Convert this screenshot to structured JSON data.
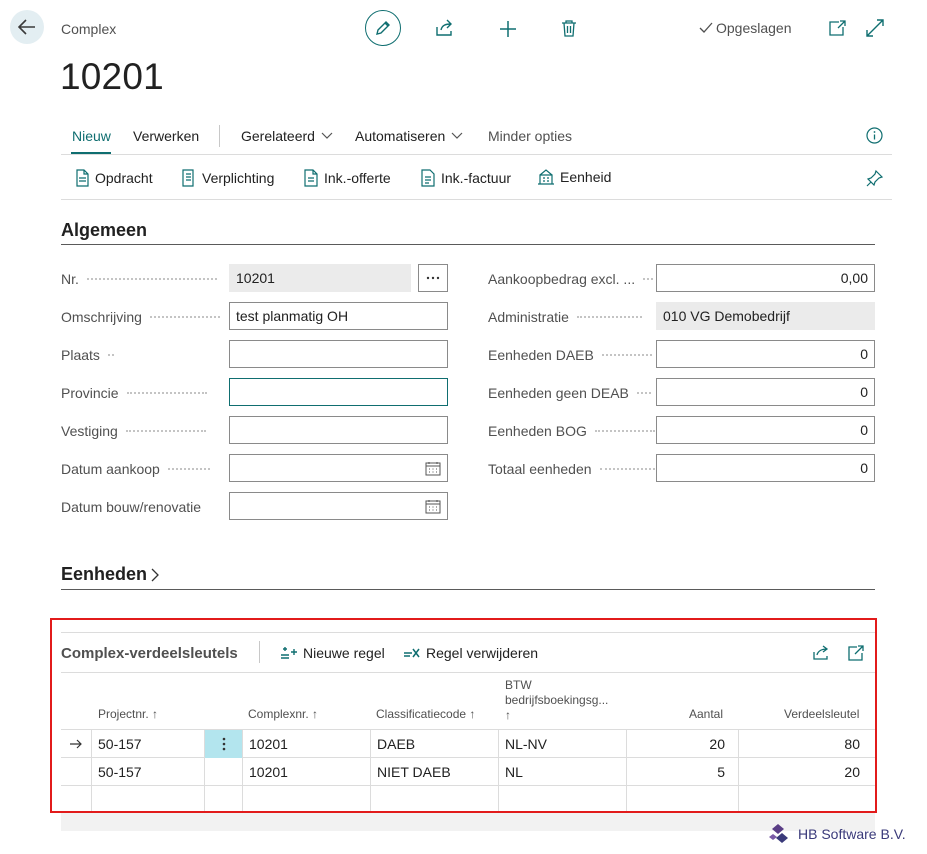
{
  "header": {
    "breadcrumb": "Complex",
    "title": "10201",
    "saved_status": "Opgeslagen"
  },
  "actions": {
    "tabs": [
      "Nieuw",
      "Verwerken",
      "Gerelateerd",
      "Automatiseren",
      "Minder opties"
    ],
    "items": [
      "Opdracht",
      "Verplichting",
      "Ink.-offerte",
      "Ink.-factuur",
      "Eenheid"
    ]
  },
  "general": {
    "title": "Algemeen",
    "left": [
      {
        "label": "Nr.",
        "value": "10201"
      },
      {
        "label": "Omschrijving",
        "value": "test planmatig OH"
      },
      {
        "label": "Plaats",
        "value": ""
      },
      {
        "label": "Provincie",
        "value": ""
      },
      {
        "label": "Vestiging",
        "value": ""
      },
      {
        "label": "Datum aankoop",
        "value": ""
      },
      {
        "label": "Datum bouw/renovatie",
        "value": ""
      }
    ],
    "right": [
      {
        "label": "Aankoopbedrag excl. ...",
        "value": "0,00"
      },
      {
        "label": "Administratie",
        "value": "010 VG Demobedrijf"
      },
      {
        "label": "Eenheden DAEB",
        "value": "0"
      },
      {
        "label": "Eenheden geen DEAB",
        "value": "0"
      },
      {
        "label": "Eenheden BOG",
        "value": "0"
      },
      {
        "label": "Totaal eenheden",
        "value": "0"
      }
    ]
  },
  "units_section": {
    "title": "Eenheden"
  },
  "part": {
    "title": "Complex-verdeelsleutels",
    "new_line": "Nieuwe regel",
    "delete_line": "Regel verwijderen",
    "columns": [
      "Projectnr. ↑",
      "Complexnr. ↑",
      "Classificatiecode ↑",
      "BTW",
      "bedrijfsboekingsg...",
      "↑",
      "Aantal",
      "Verdeelsleutel"
    ],
    "rows": [
      {
        "project": "50-157",
        "complex": "10201",
        "class": "DAEB",
        "btw": "NL-NV",
        "aantal": "20",
        "sleutel": "80"
      },
      {
        "project": "50-157",
        "complex": "10201",
        "class": "NIET DAEB",
        "btw": "NL",
        "aantal": "5",
        "sleutel": "20"
      }
    ]
  },
  "footer": {
    "brand": "HB Software B.V."
  },
  "colors": {
    "accent": "#0f6e70",
    "highlight_border": "#e21b1b",
    "row_menu_bg": "#b3e5ee"
  }
}
